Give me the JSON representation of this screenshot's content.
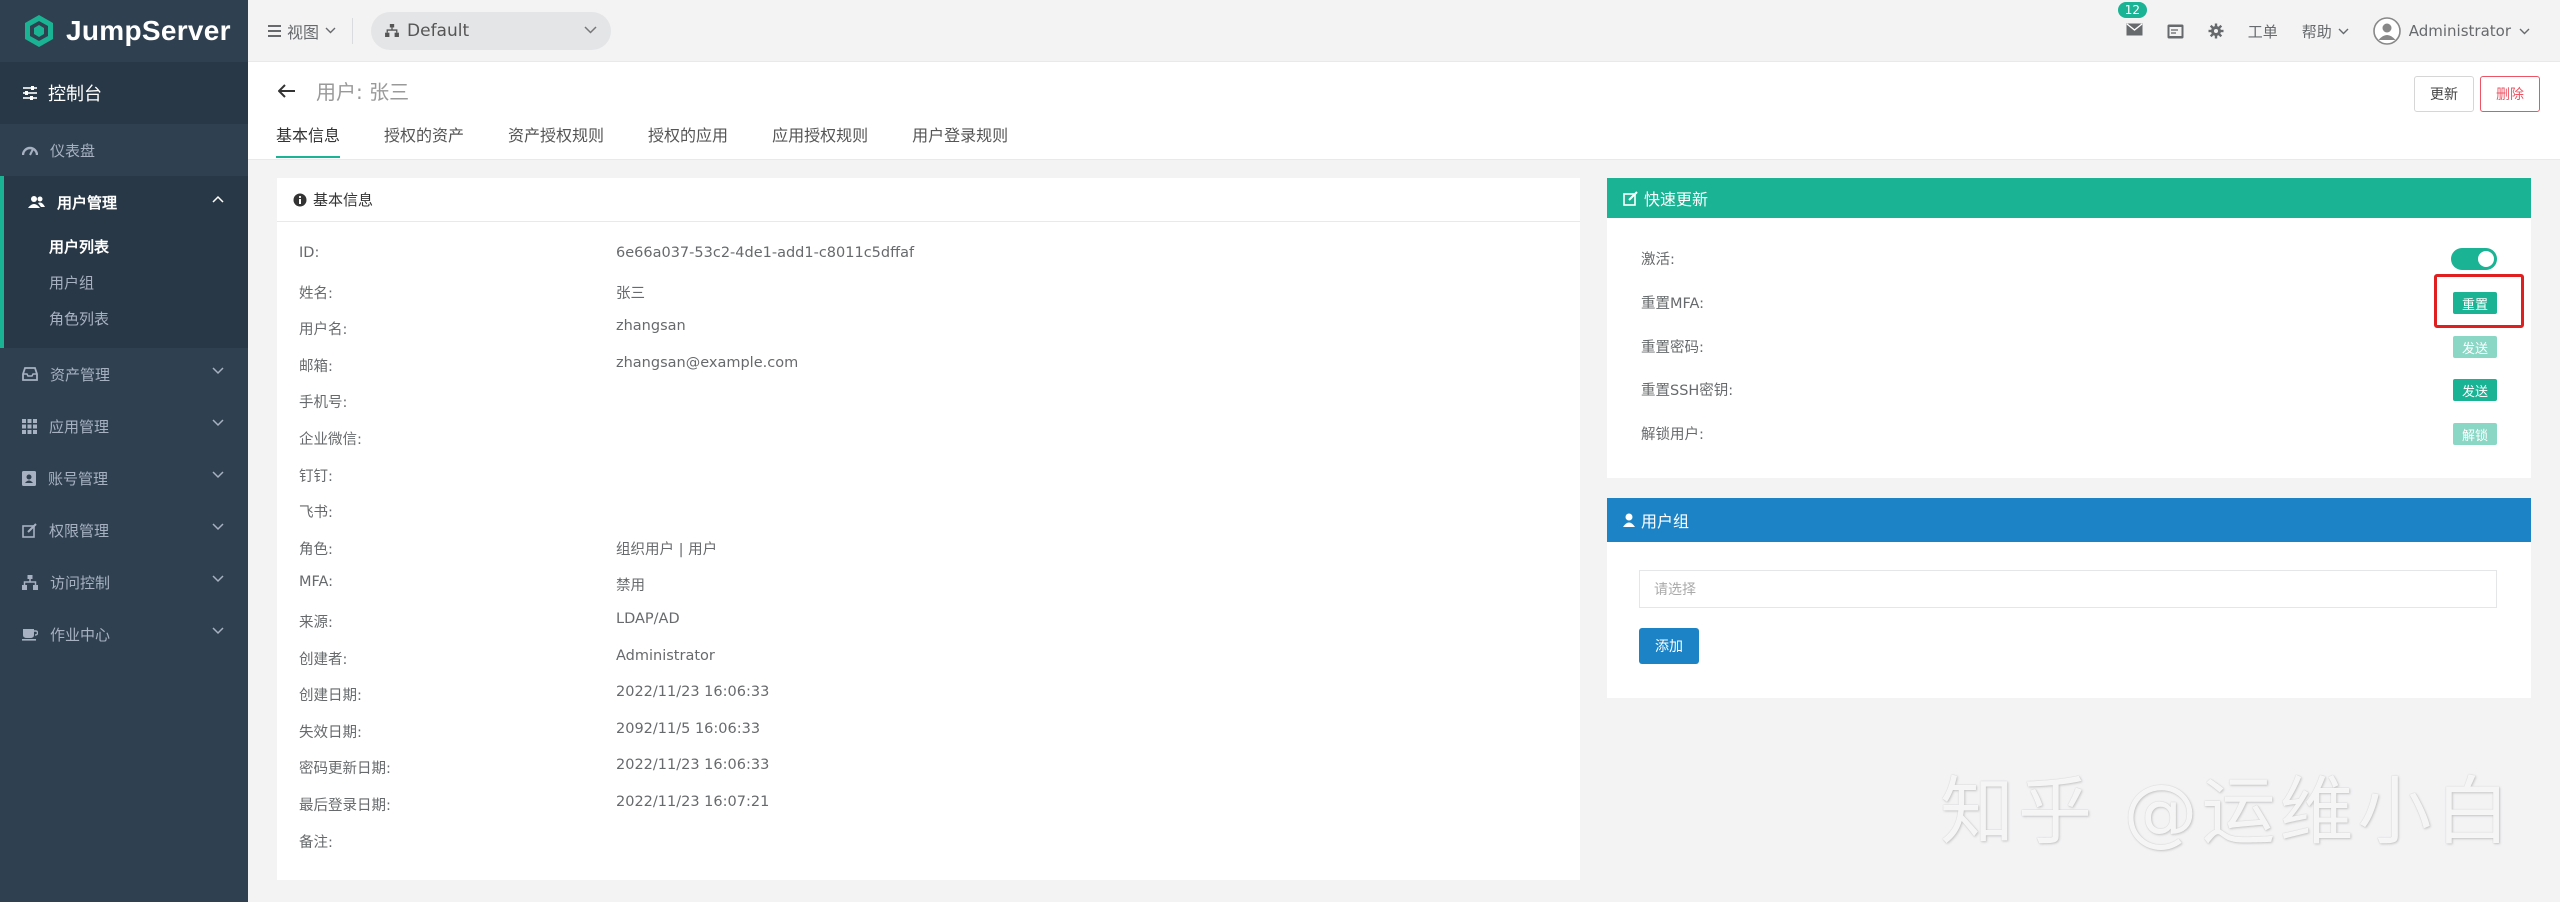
{
  "sidebar": {
    "logo": "JumpServer",
    "console": "控制台",
    "items": [
      {
        "label": "仪表盘",
        "icon": "dashboard-icon"
      },
      {
        "label": "用户管理",
        "icon": "users-icon"
      },
      {
        "label": "资产管理",
        "icon": "inbox-icon"
      },
      {
        "label": "应用管理",
        "icon": "grid-icon"
      },
      {
        "label": "账号管理",
        "icon": "address-book-icon"
      },
      {
        "label": "权限管理",
        "icon": "edit-icon"
      },
      {
        "label": "访问控制",
        "icon": "sitemap-icon"
      },
      {
        "label": "作业中心",
        "icon": "coffee-icon"
      }
    ],
    "sub_items": [
      "用户列表",
      "用户组",
      "角色列表"
    ]
  },
  "topnav": {
    "view": "视图",
    "org": "Default",
    "mail_count": "12",
    "ticket": "工单",
    "help": "帮助",
    "user": "Administrator"
  },
  "header": {
    "title": "用户: 张三",
    "update": "更新",
    "delete": "删除",
    "tabs": [
      "基本信息",
      "授权的资产",
      "资产授权规则",
      "授权的应用",
      "应用授权规则",
      "用户登录规则"
    ]
  },
  "info": {
    "title": "基本信息",
    "rows": [
      {
        "key": "ID:",
        "value": "6e66a037-53c2-4de1-add1-c8011c5dffaf"
      },
      {
        "key": "姓名:",
        "value": "张三"
      },
      {
        "key": "用户名:",
        "value": "zhangsan"
      },
      {
        "key": "邮箱:",
        "value": "zhangsan@example.com"
      },
      {
        "key": "手机号:",
        "value": ""
      },
      {
        "key": "企业微信:",
        "value": ""
      },
      {
        "key": "钉钉:",
        "value": ""
      },
      {
        "key": "飞书:",
        "value": ""
      },
      {
        "key": "角色:",
        "value": "组织用户 | 用户"
      },
      {
        "key": "MFA:",
        "value": "禁用"
      },
      {
        "key": "来源:",
        "value": "LDAP/AD"
      },
      {
        "key": "创建者:",
        "value": "Administrator"
      },
      {
        "key": "创建日期:",
        "value": "2022/11/23 16:06:33"
      },
      {
        "key": "失效日期:",
        "value": "2092/11/5 16:06:33"
      },
      {
        "key": "密码更新日期:",
        "value": "2022/11/23 16:06:33"
      },
      {
        "key": "最后登录日期:",
        "value": "2022/11/23 16:07:21"
      },
      {
        "key": "备注:",
        "value": ""
      }
    ]
  },
  "quick": {
    "title": "快速更新",
    "active_label": "激活:",
    "active": true,
    "rows": [
      {
        "label": "重置MFA:",
        "button": "重置",
        "enabled": true
      },
      {
        "label": "重置密码:",
        "button": "发送",
        "enabled": false
      },
      {
        "label": "重置SSH密钥:",
        "button": "发送",
        "enabled": true
      },
      {
        "label": "解锁用户:",
        "button": "解锁",
        "enabled": false
      }
    ]
  },
  "group": {
    "title": "用户组",
    "placeholder": "请选择",
    "add": "添加"
  },
  "watermark": "知乎 @运维小白"
}
